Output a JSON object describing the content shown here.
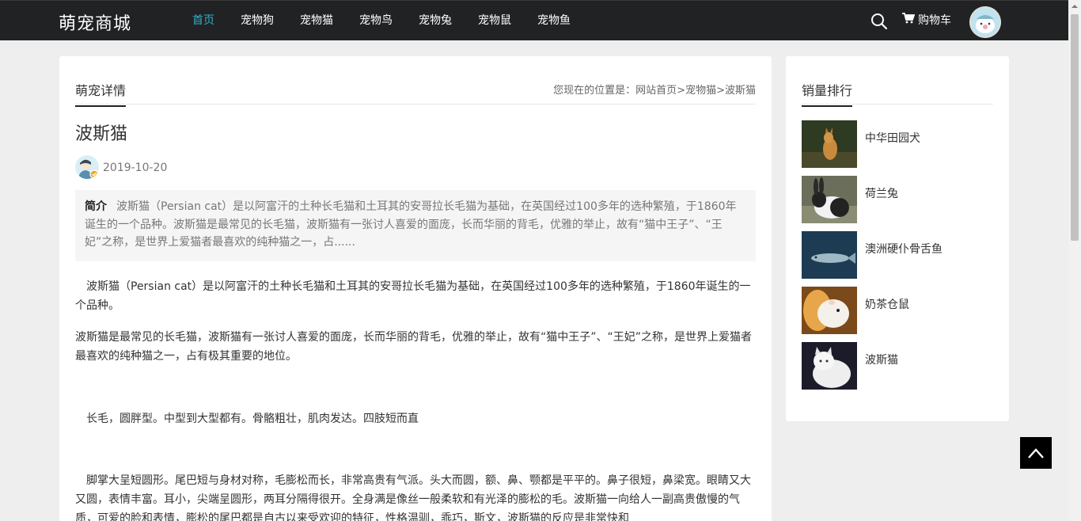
{
  "header": {
    "brand": "萌宠商城",
    "nav": [
      "首页",
      "宠物狗",
      "宠物猫",
      "宠物鸟",
      "宠物兔",
      "宠物鼠",
      "宠物鱼"
    ],
    "active_index": 0,
    "cart_label": "购物车",
    "accent_color": "#2fb0c9"
  },
  "detail": {
    "tab_label": "萌宠详情",
    "breadcrumb_prefix": "您现在的位置是：",
    "breadcrumb": [
      "网站首页",
      "宠物猫",
      "波斯猫"
    ],
    "breadcrumb_sep": ">",
    "title": "波斯猫",
    "date": "2019-10-20",
    "summary_label": "简介",
    "summary_text": "波斯猫（Persian cat）是以阿富汗的土种长毛猫和土耳其的安哥拉长毛猫为基础，在英国经过100多年的选种繁殖，于1860年诞生的一个品种。波斯猫是最常见的长毛猫，波斯猫有一张讨人喜爱的面庞，长而华丽的背毛，优雅的举止，故有“猫中王子”、“王妃”之称，是世界上爱猫者最喜欢的纯种猫之一，占......",
    "paragraphs": [
      "　波斯猫（Persian cat）是以阿富汗的土种长毛猫和土耳其的安哥拉长毛猫为基础，在英国经过100多年的选种繁殖，于1860年诞生的一个品种。",
      "波斯猫是最常见的长毛猫，波斯猫有一张讨人喜爱的面庞，长而华丽的背毛，优雅的举止，故有“猫中王子”、“王妃”之称，是世界上爱猫者最喜欢的纯种猫之一，占有极其重要的地位。",
      "　长毛，圆胖型。中型到大型都有。骨骼粗壮，肌肉发达。四肢短而直",
      "　脚掌大呈短圆形。尾巴短与身材对称，毛膨松而长，非常高贵有气派。头大而圆，额、鼻、颚都是平平的。鼻子很短，鼻梁宽。眼睛又大又圆，表情丰富。耳小，尖端呈圆形，两耳分隔得很开。全身满是像丝一般柔软和有光泽的膨松的毛。波斯猫一向给人一副高贵傲慢的气质，可爱的脸和表情，膨松的尾巴都是自古以来受欢迎的特征，性格温驯，乖巧，斯文，波斯猫的反应是非常快和"
    ]
  },
  "sidebar": {
    "title": "销量排行",
    "items": [
      {
        "name": "中华田园犬",
        "icon": "dog-photo"
      },
      {
        "name": "荷兰兔",
        "icon": "rabbit-photo"
      },
      {
        "name": "澳洲硬仆骨舌鱼",
        "icon": "fish-photo"
      },
      {
        "name": "奶茶仓鼠",
        "icon": "hamster-photo"
      },
      {
        "name": "波斯猫",
        "icon": "cat-photo"
      }
    ]
  }
}
